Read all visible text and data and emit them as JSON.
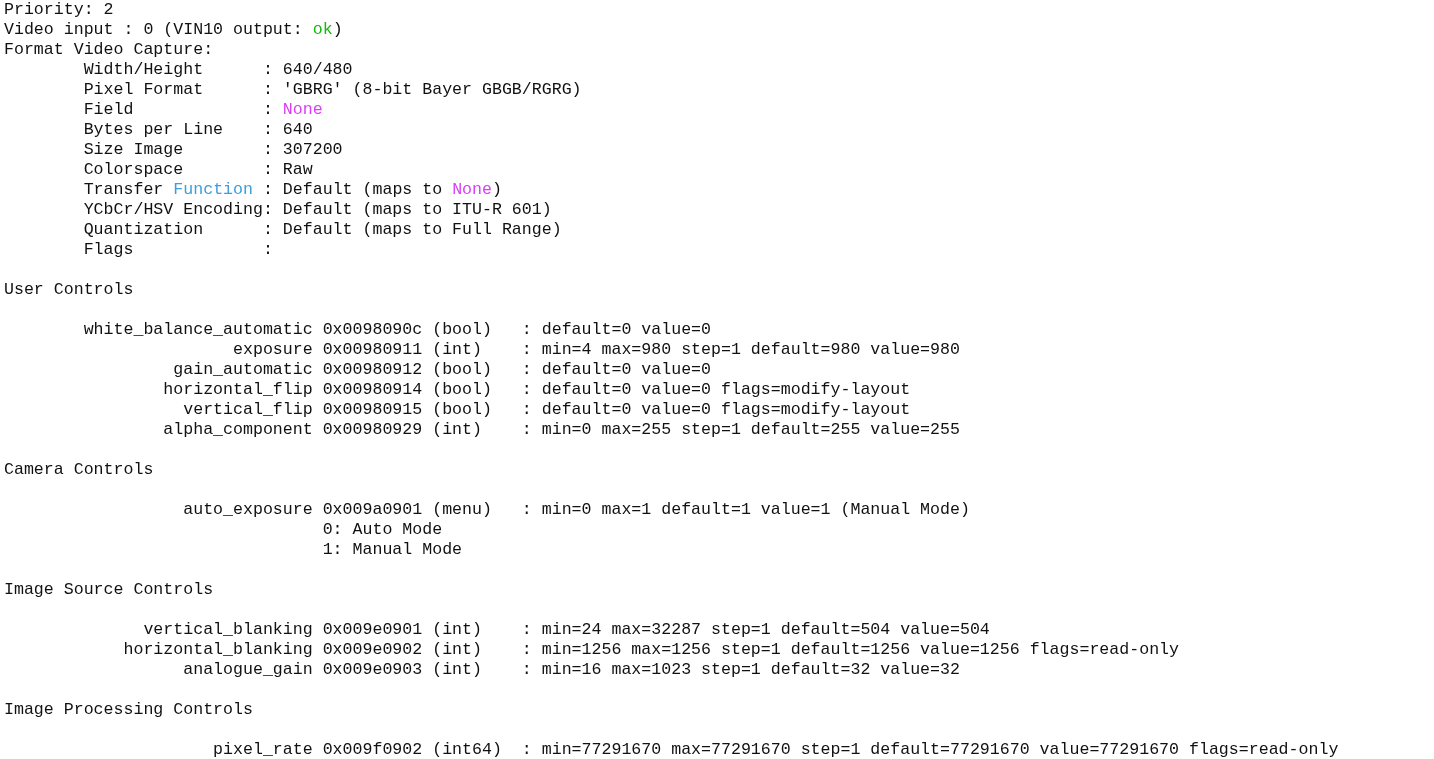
{
  "terminal": {
    "lines": [
      {
        "kind": "text",
        "segments": [
          {
            "text": "Priority: 2"
          }
        ]
      },
      {
        "kind": "text",
        "segments": [
          {
            "text": "Video input : 0 (VIN10 output: "
          },
          {
            "text": "ok",
            "color": "#16b80c"
          },
          {
            "text": ")"
          }
        ]
      },
      {
        "kind": "text",
        "segments": [
          {
            "text": "Format Video Capture:"
          }
        ]
      },
      {
        "kind": "text",
        "segments": [
          {
            "text": "        Width/Height      : 640/480"
          }
        ]
      },
      {
        "kind": "text",
        "segments": [
          {
            "text": "        Pixel Format      : 'GBRG' (8-bit Bayer GBGB/RGRG)"
          }
        ]
      },
      {
        "kind": "text",
        "segments": [
          {
            "text": "        Field             : "
          },
          {
            "text": "None",
            "color": "#d93ef5"
          }
        ]
      },
      {
        "kind": "text",
        "segments": [
          {
            "text": "        Bytes per Line    : 640"
          }
        ]
      },
      {
        "kind": "text",
        "segments": [
          {
            "text": "        Size Image        : 307200"
          }
        ]
      },
      {
        "kind": "text",
        "segments": [
          {
            "text": "        Colorspace        : Raw"
          }
        ]
      },
      {
        "kind": "text",
        "segments": [
          {
            "text": "        Transfer "
          },
          {
            "text": "Function",
            "color": "#3a9ee0"
          },
          {
            "text": " : Default (maps to "
          },
          {
            "text": "None",
            "color": "#d93ef5"
          },
          {
            "text": ")"
          }
        ]
      },
      {
        "kind": "text",
        "segments": [
          {
            "text": "        YCbCr/HSV Encoding: Default (maps to ITU-R 601)"
          }
        ]
      },
      {
        "kind": "text",
        "segments": [
          {
            "text": "        Quantization      : Default (maps to Full Range)"
          }
        ]
      },
      {
        "kind": "text",
        "segments": [
          {
            "text": "        Flags             :"
          }
        ]
      },
      {
        "kind": "blank"
      },
      {
        "kind": "text",
        "segments": [
          {
            "text": "User Controls"
          }
        ]
      },
      {
        "kind": "blank"
      },
      {
        "kind": "text",
        "segments": [
          {
            "text": "        white_balance_automatic 0x0098090c (bool)   : default=0 value=0"
          }
        ]
      },
      {
        "kind": "text",
        "segments": [
          {
            "text": "                       exposure 0x00980911 (int)    : min=4 max=980 step=1 default=980 value=980"
          }
        ]
      },
      {
        "kind": "text",
        "segments": [
          {
            "text": "                 gain_automatic 0x00980912 (bool)   : default=0 value=0"
          }
        ]
      },
      {
        "kind": "text",
        "segments": [
          {
            "text": "                horizontal_flip 0x00980914 (bool)   : default=0 value=0 flags=modify-layout"
          }
        ]
      },
      {
        "kind": "text",
        "segments": [
          {
            "text": "                  vertical_flip 0x00980915 (bool)   : default=0 value=0 flags=modify-layout"
          }
        ]
      },
      {
        "kind": "text",
        "segments": [
          {
            "text": "                alpha_component 0x00980929 (int)    : min=0 max=255 step=1 default=255 value=255"
          }
        ]
      },
      {
        "kind": "blank"
      },
      {
        "kind": "text",
        "segments": [
          {
            "text": "Camera Controls"
          }
        ]
      },
      {
        "kind": "blank"
      },
      {
        "kind": "text",
        "segments": [
          {
            "text": "                  auto_exposure 0x009a0901 (menu)   : min=0 max=1 default=1 value=1 (Manual Mode)"
          }
        ]
      },
      {
        "kind": "text",
        "segments": [
          {
            "text": "                                0: Auto Mode"
          }
        ]
      },
      {
        "kind": "text",
        "segments": [
          {
            "text": "                                1: Manual Mode"
          }
        ]
      },
      {
        "kind": "blank"
      },
      {
        "kind": "text",
        "segments": [
          {
            "text": "Image Source Controls"
          }
        ]
      },
      {
        "kind": "blank"
      },
      {
        "kind": "text",
        "segments": [
          {
            "text": "              vertical_blanking 0x009e0901 (int)    : min=24 max=32287 step=1 default=504 value=504"
          }
        ]
      },
      {
        "kind": "text",
        "segments": [
          {
            "text": "            horizontal_blanking 0x009e0902 (int)    : min=1256 max=1256 step=1 default=1256 value=1256 flags=read-only"
          }
        ]
      },
      {
        "kind": "text",
        "segments": [
          {
            "text": "                  analogue_gain 0x009e0903 (int)    : min=16 max=1023 step=1 default=32 value=32"
          }
        ]
      },
      {
        "kind": "blank"
      },
      {
        "kind": "text",
        "segments": [
          {
            "text": "Image Processing Controls"
          }
        ]
      },
      {
        "kind": "blank"
      },
      {
        "kind": "text",
        "segments": [
          {
            "text": "                     pixel_rate 0x009f0902 (int64)  : min=77291670 max=77291670 step=1 default=77291670 value=77291670 flags=read-only"
          }
        ]
      }
    ]
  }
}
